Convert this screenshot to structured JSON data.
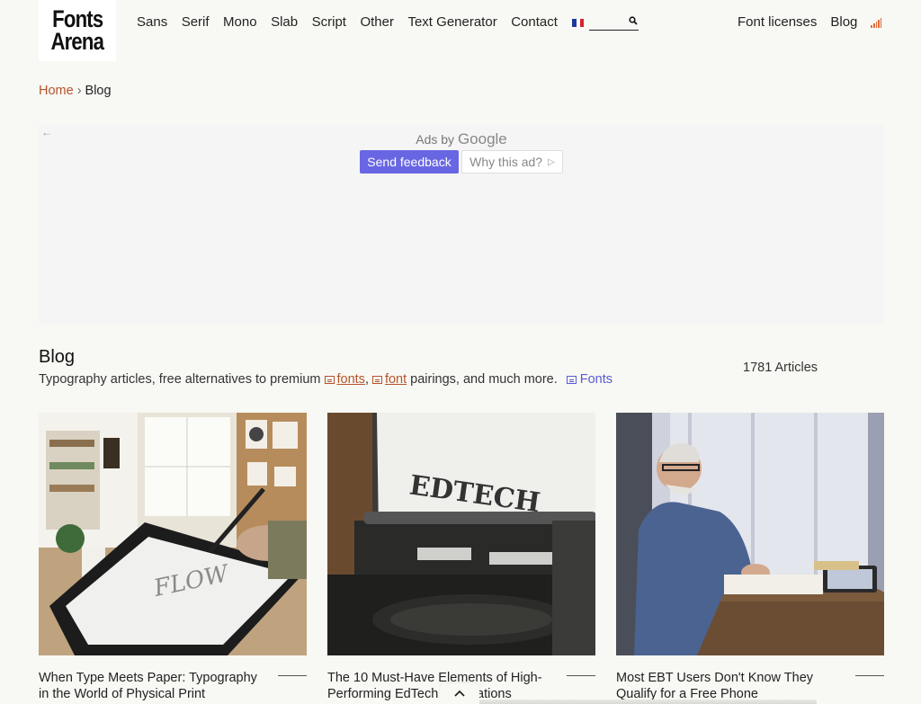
{
  "logo": {
    "line1": "Fonts",
    "line2": "Arena"
  },
  "nav": {
    "items": [
      "Sans",
      "Serif",
      "Mono",
      "Slab",
      "Script",
      "Other",
      "Text Generator",
      "Contact"
    ]
  },
  "search": {
    "placeholder": ""
  },
  "right_nav": {
    "licenses": "Font licenses",
    "blog": "Blog"
  },
  "breadcrumb": {
    "home": "Home",
    "separator": "›",
    "current": "Blog"
  },
  "ad": {
    "ads_by": "Ads by",
    "google": "Google",
    "feedback": "Send feedback",
    "why": "Why this ad?"
  },
  "blog": {
    "title": "Blog",
    "sub_start": "Typography articles, free alternatives to premium",
    "kw1": "fonts",
    "comma": ",",
    "kw2": "font",
    "sub_end": "pairings, and much more.",
    "kw3": "Fonts",
    "count": "1781 Articles"
  },
  "articles": [
    {
      "title": "When Type Meets Paper: Typography in the World of Physical Print",
      "image": "drawing-tablet-illustration"
    },
    {
      "title": "The 10 Must-Have Elements of High-Performing EdTech Applications",
      "image": "typewriter-edtech"
    },
    {
      "title": "Most EBT Users Don't Know They Qualify for a Free Phone",
      "image": "man-writing-at-desk"
    }
  ],
  "colors": {
    "accent": "#b5532a",
    "ad_button": "#6966e3",
    "background": "#f8f8f4"
  }
}
